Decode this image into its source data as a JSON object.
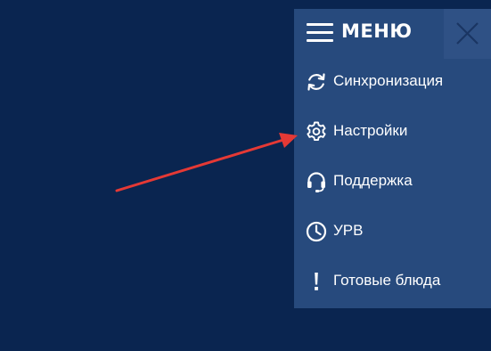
{
  "menu": {
    "title": "МЕНЮ",
    "items": [
      {
        "label": "Синхронизация",
        "icon": "sync-icon"
      },
      {
        "label": "Настройки",
        "icon": "gear-icon"
      },
      {
        "label": "Поддержка",
        "icon": "headset-icon"
      },
      {
        "label": "УРВ",
        "icon": "clock-icon"
      },
      {
        "label": "Готовые блюда",
        "icon": "exclamation-icon"
      }
    ]
  },
  "colors": {
    "background": "#0a2550",
    "menu_panel": "#274a7d",
    "close_button": "#2f5185",
    "annotation_arrow": "#e53935"
  }
}
